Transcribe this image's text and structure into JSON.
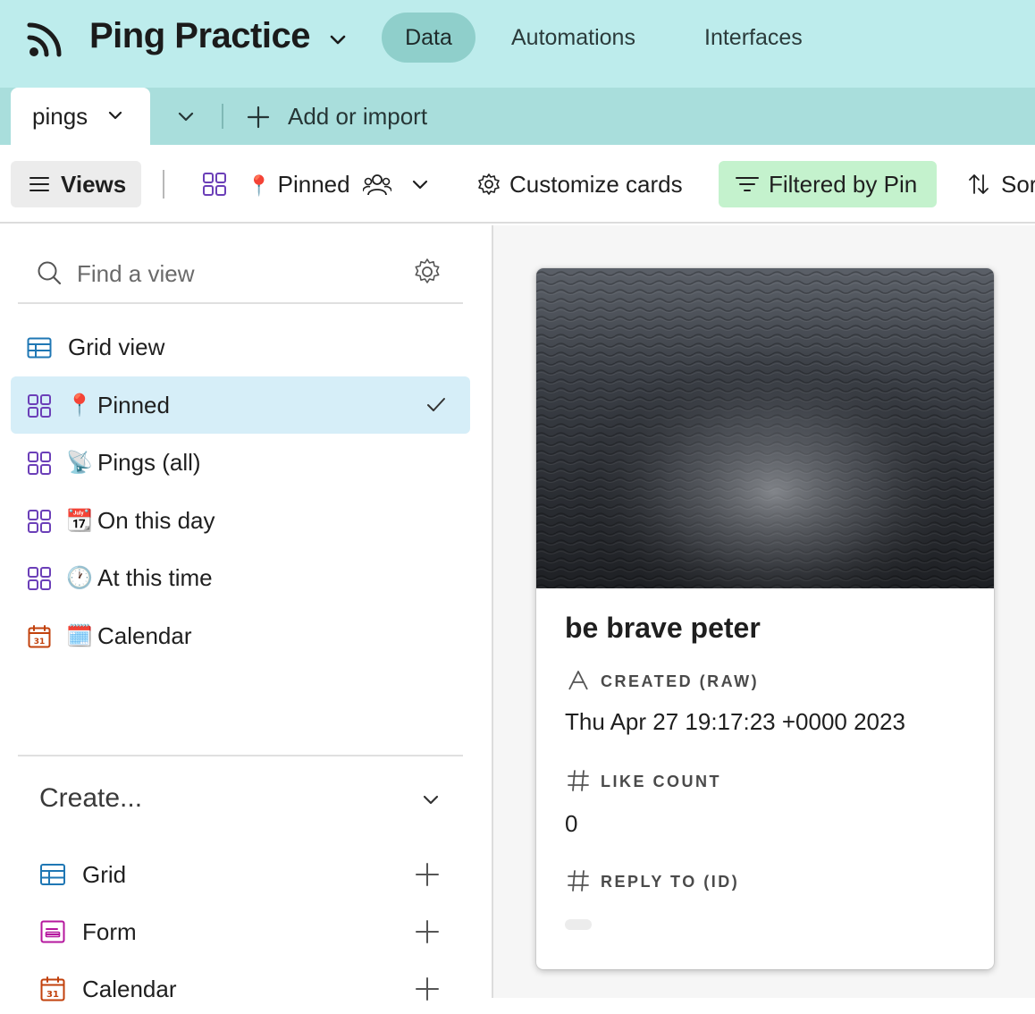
{
  "app": {
    "title": "Ping Practice",
    "nav": [
      "Data",
      "Automations",
      "Interfaces"
    ],
    "active_nav": "Data"
  },
  "tables": {
    "current": "pings",
    "add_label": "Add or import"
  },
  "toolbar": {
    "views_label": "Views",
    "current_view_emoji": "📍",
    "current_view": "Pinned",
    "customize_label": "Customize cards",
    "filter_label": "Filtered by Pin",
    "sort_label": "Sort"
  },
  "sidebar": {
    "search_placeholder": "Find a view",
    "views": [
      {
        "icon": "grid-view-icon",
        "emoji": "",
        "label": "Grid view",
        "active": false
      },
      {
        "icon": "gallery-view-icon",
        "emoji": "📍",
        "label": "Pinned",
        "active": true
      },
      {
        "icon": "gallery-view-icon",
        "emoji": "📡",
        "label": "Pings (all)",
        "active": false
      },
      {
        "icon": "gallery-view-icon",
        "emoji": "📆",
        "label": "On this day",
        "active": false
      },
      {
        "icon": "gallery-view-icon",
        "emoji": "🕐",
        "label": "At this time",
        "active": false
      },
      {
        "icon": "calendar-view-icon",
        "emoji": "🗓️",
        "label": "Calendar",
        "active": false
      }
    ],
    "create_title": "Create...",
    "create_items": [
      {
        "icon": "grid-icon",
        "label": "Grid"
      },
      {
        "icon": "form-icon",
        "label": "Form"
      },
      {
        "icon": "calendar-icon",
        "label": "Calendar"
      }
    ]
  },
  "card": {
    "title": "be brave peter",
    "fields": [
      {
        "label": "CREATED (RAW)",
        "icon": "text-field-icon",
        "value": "Thu Apr 27 19:17:23 +0000 2023"
      },
      {
        "label": "LIKE COUNT",
        "icon": "number-field-icon",
        "value": "0"
      },
      {
        "label": "REPLY TO (ID)",
        "icon": "number-field-icon",
        "value": ""
      }
    ]
  },
  "colors": {
    "topbar": "#bdecec",
    "tabbar": "#a9dedc",
    "active_nav": "#8fcfcb",
    "active_view": "#d6eef8",
    "filter_bg": "#c4f2cd",
    "gallery_icon": "#6b3fb8",
    "grid_icon": "#1f77b4",
    "calendar_icon": "#c2410c",
    "form_icon": "#b5179e"
  }
}
